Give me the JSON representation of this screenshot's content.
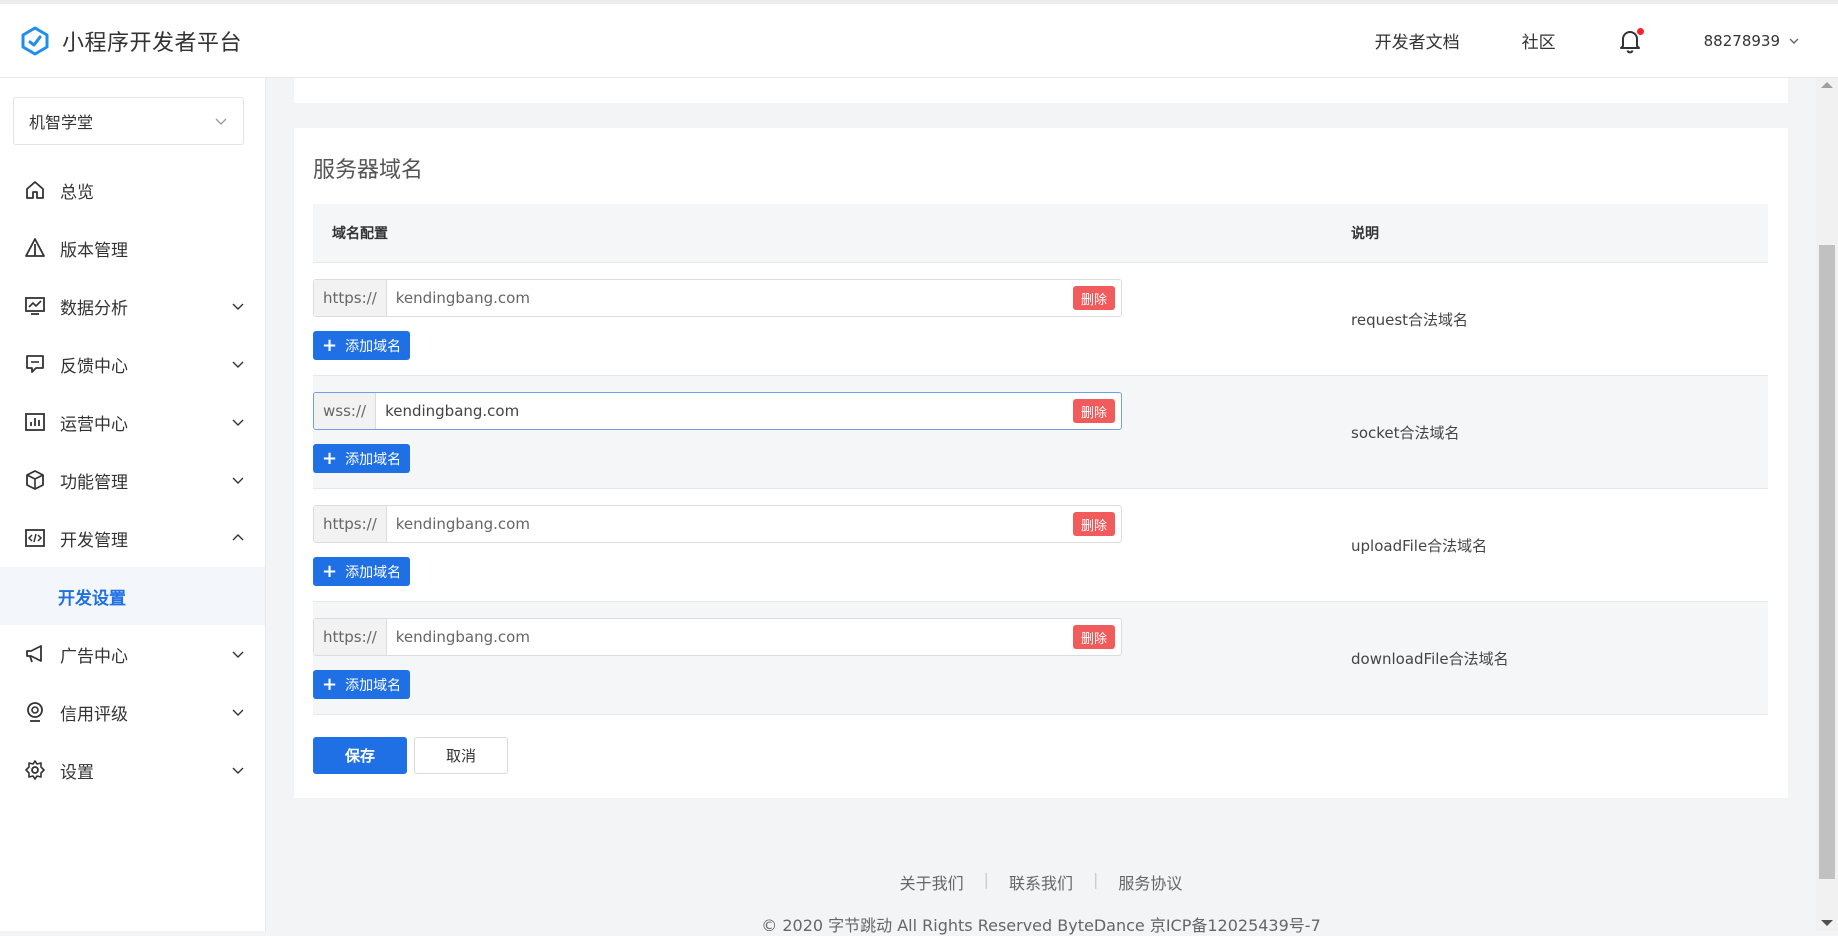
{
  "header": {
    "logo_text": "小程序开发者平台",
    "links": [
      "开发者文档",
      "社区"
    ],
    "account_id": "88278939"
  },
  "sidebar": {
    "app_name": "机智学堂",
    "items": [
      {
        "label": "总览",
        "icon": "home-icon",
        "expandable": false
      },
      {
        "label": "版本管理",
        "icon": "version-icon",
        "expandable": false
      },
      {
        "label": "数据分析",
        "icon": "chart-icon",
        "expandable": true
      },
      {
        "label": "反馈中心",
        "icon": "feedback-icon",
        "expandable": true
      },
      {
        "label": "运营中心",
        "icon": "operation-icon",
        "expandable": true
      },
      {
        "label": "功能管理",
        "icon": "cube-icon",
        "expandable": true
      },
      {
        "label": "开发管理",
        "icon": "code-icon",
        "expandable": true,
        "expanded": true
      },
      {
        "label": "广告中心",
        "icon": "megaphone-icon",
        "expandable": true
      },
      {
        "label": "信用评级",
        "icon": "badge-icon",
        "expandable": true
      },
      {
        "label": "设置",
        "icon": "gear-icon",
        "expandable": true
      }
    ],
    "active_sub": "开发设置"
  },
  "main": {
    "section_title": "服务器域名",
    "columns": [
      "域名配置",
      "说明"
    ],
    "rows": [
      {
        "prefix": "https://",
        "value": "kendingbang.com",
        "description": "request合法域名"
      },
      {
        "prefix": "wss://",
        "value": "kendingbang.com",
        "description": "socket合法域名"
      },
      {
        "prefix": "https://",
        "value": "kendingbang.com",
        "description": "uploadFile合法域名"
      },
      {
        "prefix": "https://",
        "value": "kendingbang.com",
        "description": "downloadFile合法域名"
      }
    ],
    "delete_label": "删除",
    "add_label": "添加域名",
    "save_label": "保存",
    "cancel_label": "取消"
  },
  "footer": {
    "links": [
      "关于我们",
      "联系我们",
      "服务协议"
    ],
    "copyright": "© 2020 字节跳动 All Rights Reserved ByteDance 京ICP备12025439号-7"
  },
  "colors": {
    "primary": "#1f6fe5",
    "danger": "#f25b5b",
    "notification_dot": "#f5222d"
  }
}
